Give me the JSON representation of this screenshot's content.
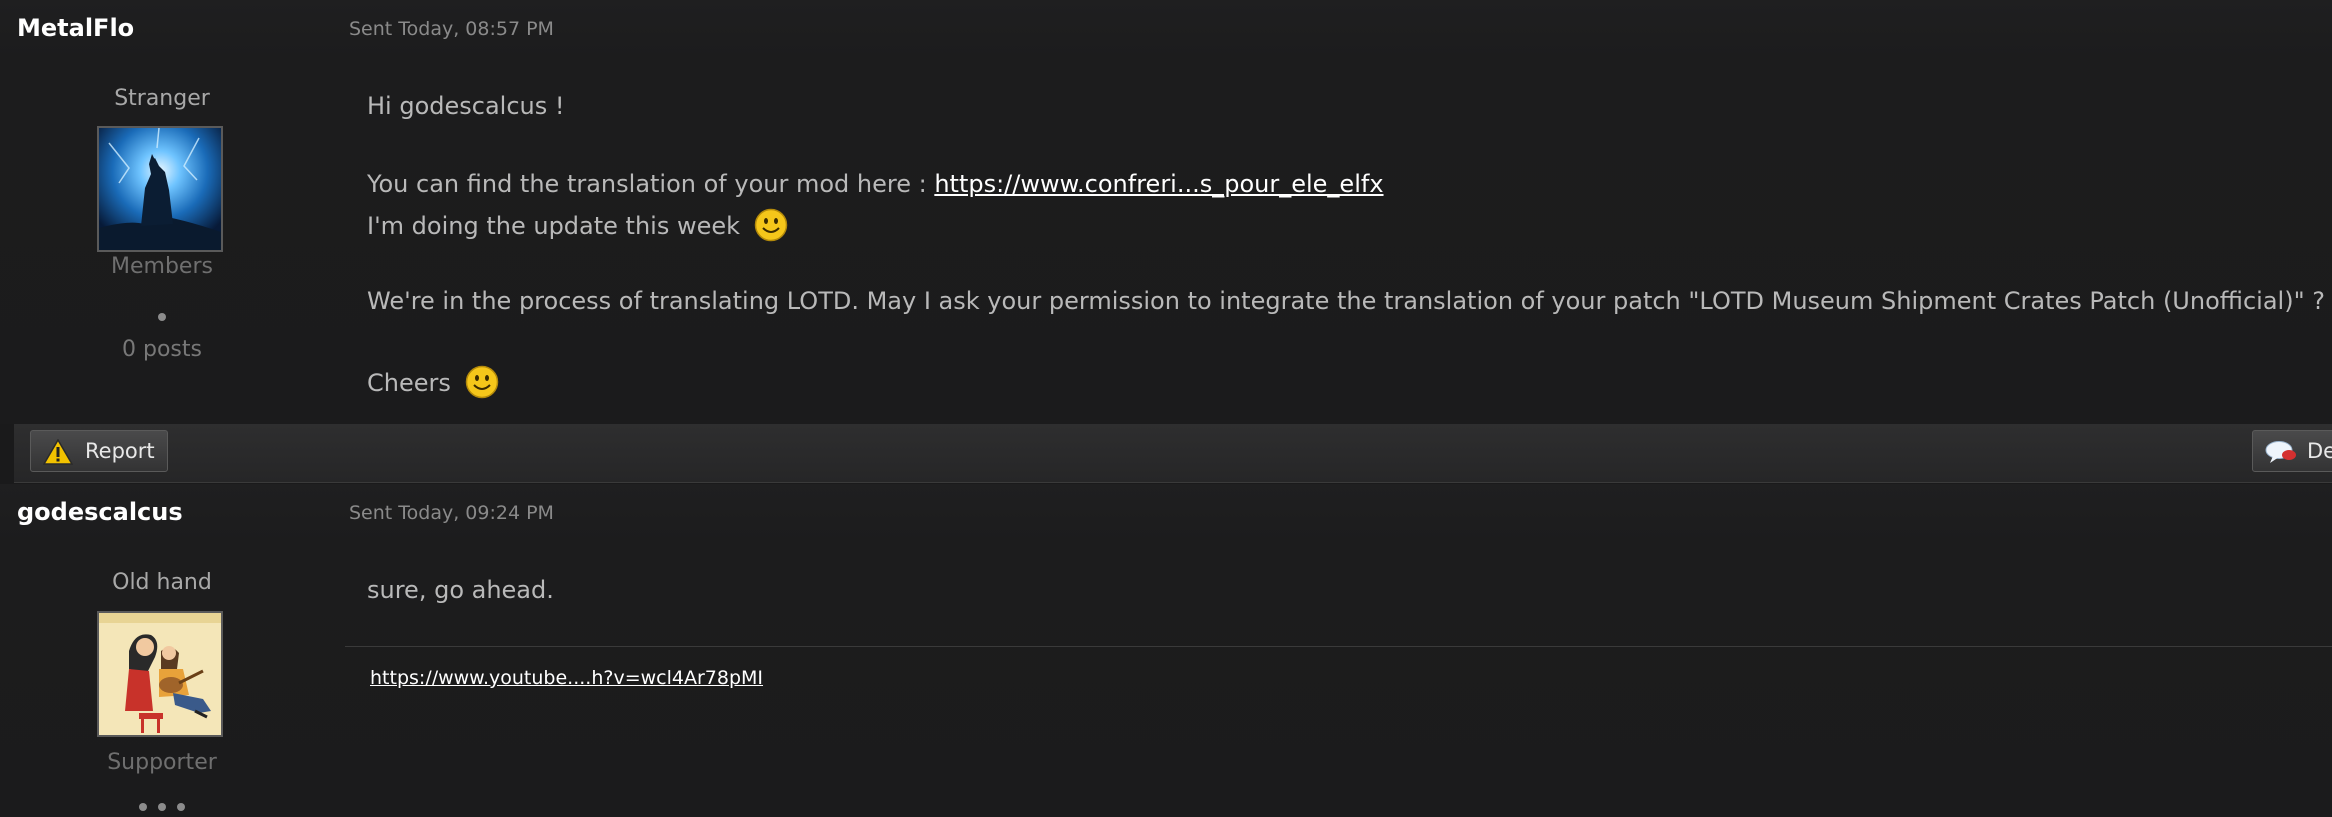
{
  "posts": [
    {
      "author": "MetalFlo",
      "sent": "Sent Today, 08:57 PM",
      "rank": "Stranger",
      "group": "Members",
      "post_count": "0 posts",
      "lines": {
        "greeting": "Hi godescalcus !",
        "find_prefix": "You can find the translation of your mod here : ",
        "find_link": "https://www.confreri...s_pour_ele_elfx",
        "update": "I'm doing the update this week",
        "process": "We're in the process of translating LOTD. May I ask your permission to integrate the translation of your patch \"LOTD Museum Shipment Crates Patch (Unofficial)\" ?",
        "cheers": "Cheers"
      }
    },
    {
      "author": "godescalcus",
      "sent": "Sent Today, 09:24 PM",
      "rank": "Old hand",
      "group": "Supporter",
      "lines": {
        "reply": "sure, go ahead."
      },
      "signature_link": "https://www.youtube....h?v=wcl4Ar78pMI"
    }
  ],
  "footer": {
    "report_label": "Report",
    "reply_label": "De"
  },
  "icons": [
    "warning-icon",
    "speech-bubble-icon",
    "smiley-icon"
  ],
  "colors": {
    "background": "#1a1a1b",
    "text": "#b9b9b9",
    "link": "#ffffff",
    "muted": "#8a8a8a"
  }
}
